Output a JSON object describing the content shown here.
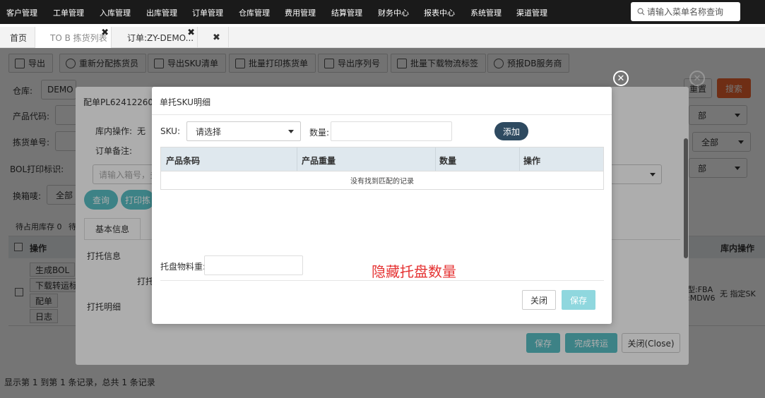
{
  "nav": {
    "items": [
      "客户管理",
      "工单管理",
      "入库管理",
      "出库管理",
      "订单管理",
      "仓库管理",
      "费用管理",
      "结算管理",
      "财务中心",
      "报表中心",
      "系统管理",
      "渠道管理"
    ],
    "search_placeholder": "请输入菜单名称查询"
  },
  "tabs": [
    {
      "label": "首页"
    },
    {
      "label": "TO B 拣货列表"
    },
    {
      "label": "订单:ZY-DEMO..."
    }
  ],
  "toolbar": [
    "导出",
    "重新分配拣货员",
    "导出SKU清单",
    "批量打印拣货单",
    "导出序列号",
    "批量下载物流标签",
    "预报DB服务商"
  ],
  "filters": {
    "warehouse_label": "仓库:",
    "warehouse_value": "DEMO",
    "product_code_label": "产品代码:",
    "picking_no_label": "拣货单号:",
    "bol_label": "BOL打印标识:",
    "bol_input_placeholder": "请输入箱号，多",
    "change_label": "换箱唛:",
    "change_value": "全部",
    "select_all_1": "全部",
    "select_all_2": "全部",
    "select_all_3": "部",
    "select_all_4": "部",
    "query_button": "查询",
    "print_button": "打印拣",
    "page_search_button": "搜索",
    "page_reset_button": "重置"
  },
  "main_table": {
    "pending_label": "待占用库存 0",
    "pending_label2": "待",
    "op_header": "操作",
    "right_header": "库内操作",
    "row_buttons": [
      "生成BOL",
      "下载转运标",
      "配单",
      "日志"
    ],
    "row_right_text": "无 指定SK",
    "row_right_type": "型:FBA",
    "row_right_code": ":MDW6"
  },
  "summary": "显示第 1 到第 1 条记录，总共 1 条记录",
  "outer_modal": {
    "title": "配单PL62412260000",
    "inbound_op_label": "库内操作:",
    "inbound_op_value": "无",
    "order_note_label": "订单备注:",
    "tab_basic": "基本信息",
    "pallet_info_label": "打托信息",
    "pallet_sub_label": "打托",
    "pallet_detail_label": "打托明细",
    "save_button": "保存",
    "complete_button": "完成转运",
    "close_button": "关闭(Close)"
  },
  "inner_modal": {
    "title": "单托SKU明细",
    "sku_label": "SKU:",
    "sku_select_value": "请选择",
    "qty_label": "数量:",
    "add_button": "添加",
    "columns": [
      "产品条码",
      "产品重量",
      "数量",
      "操作"
    ],
    "empty_text": "没有找到匹配的记录",
    "pallet_weight_label": "托盘物料重:",
    "annotation": "隐藏托盘数量",
    "close_button": "关闭",
    "save_button": "保存"
  },
  "colors": {
    "nav_bg": "#1a1a1a",
    "teal": "#5bc0c6",
    "add_button_bg": "#2e4a60",
    "annotation_red": "#e53333",
    "search_orange": "#f2662f"
  }
}
